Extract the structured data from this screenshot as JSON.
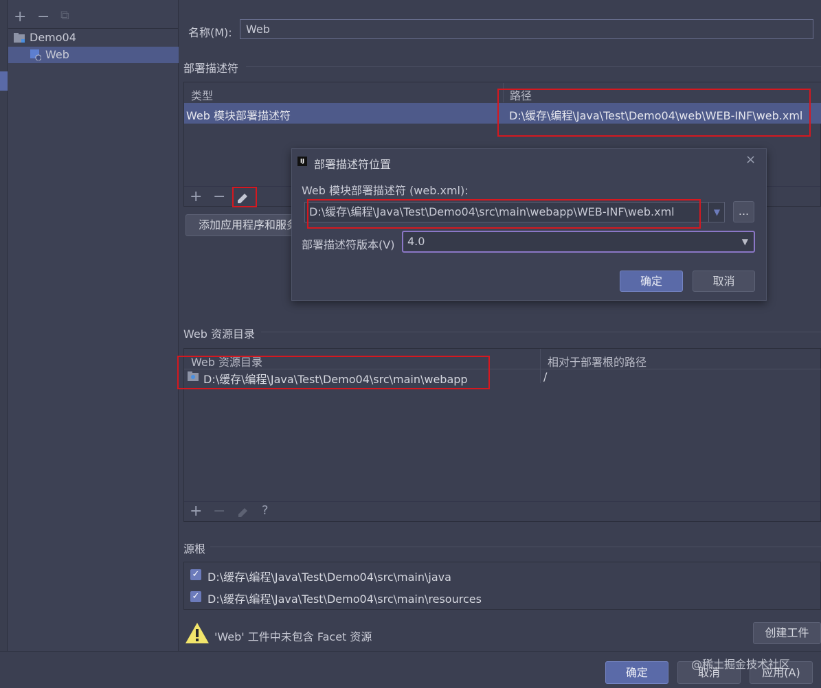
{
  "tree": {
    "toolbar": {
      "add": "+",
      "remove": "−",
      "copy": "⧉"
    },
    "items": [
      {
        "label": "Demo04"
      },
      {
        "label": "Web"
      }
    ]
  },
  "facet": {
    "name_label": "名称(M):",
    "name_value": "Web",
    "deployment_section": "部署描述符",
    "deployment_table": {
      "col_type": "类型",
      "col_path": "路径",
      "rows": [
        {
          "type": "Web 模块部署描述符",
          "path": "D:\\缓存\\编程\\Java\\Test\\Demo04\\web\\WEB-INF\\web.xml"
        }
      ]
    },
    "deployment_toolbar": {
      "add": "+",
      "remove": "−"
    },
    "add_server_button": "添加应用程序和服务",
    "web_resource_section": "Web 资源目录",
    "web_resource_table": {
      "col_dir": "Web 资源目录",
      "col_rel": "相对于部署根的路径",
      "rows": [
        {
          "dir": "D:\\缓存\\编程\\Java\\Test\\Demo04\\src\\main\\webapp",
          "rel": "/"
        }
      ]
    },
    "web_resource_toolbar": {
      "add": "+",
      "remove": "−",
      "help": "?"
    },
    "source_roots_section": "源根",
    "source_roots": [
      {
        "path": "D:\\缓存\\编程\\Java\\Test\\Demo04\\src\\main\\java",
        "checked": true
      },
      {
        "path": "D:\\缓存\\编程\\Java\\Test\\Demo04\\src\\main\\resources",
        "checked": true
      }
    ],
    "warning_text": "'Web' 工件中未包含 Facet 资源",
    "create_artifact_button": "创建工件"
  },
  "dialog": {
    "title": "部署描述符位置",
    "path_label": "Web 模块部署描述符 (web.xml):",
    "path_value": "D:\\缓存\\编程\\Java\\Test\\Demo04\\src\\main\\webapp\\WEB-INF\\web.xml",
    "browse_label": "...",
    "version_label": "部署描述符版本(V)",
    "version_value": "4.0",
    "ok": "确定",
    "cancel": "取消",
    "close": "×"
  },
  "footer": {
    "ok": "确定",
    "cancel": "取消",
    "apply": "应用(A)",
    "watermark": "@稀土掘金技术社区"
  },
  "colors": {
    "accent": "#5a6aa8",
    "selection": "#4e5a8a",
    "highlight_box": "#d6181f",
    "warning": "#f2e56b"
  }
}
